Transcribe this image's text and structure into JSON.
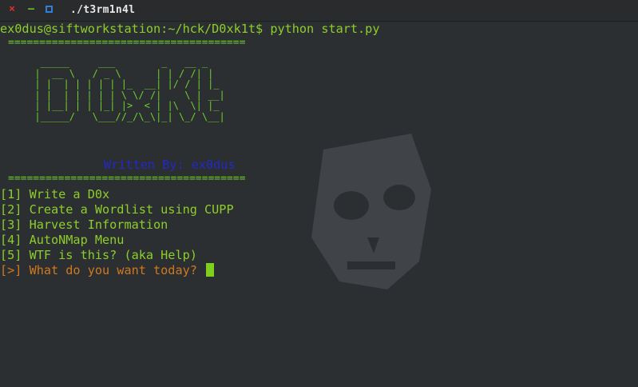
{
  "window": {
    "title": "./t3rm1n4l",
    "close_glyph": "×",
    "min_glyph": "–"
  },
  "terminal": {
    "command_line": "ex0dus@siftworkstation:~/hck/D0xk1t$ python start.py",
    "separator": "======================================",
    "banner_art": "       _____     ___        _   __ _\n      |  __ \\   / _ \\      | | / /| |\n      | |  | | | | | |_  __| |/ / | |_\n      | |  | | | | | \\ \\/ /|    \\ | __|\n      | |__| | | |_| |>  < | |\\  \\| |_\n      |_____/   \\___//_/\\_\\|_| \\_/ \\__|",
    "author_line": "Written By: ex0dus",
    "menu": [
      "[1] Write a D0x",
      "[2] Create a Wordlist using CUPP",
      "[3] Harvest Information",
      "[4] AutoNMap Menu",
      "[5] WTF is this? (aka Help)"
    ],
    "input_prompt": "[>] What do you want today? ",
    "colors": {
      "text_green": "#8dce2a",
      "author_blue": "#2328c8",
      "prompt_orange": "#d0781f",
      "background": "#2c2f32"
    }
  }
}
